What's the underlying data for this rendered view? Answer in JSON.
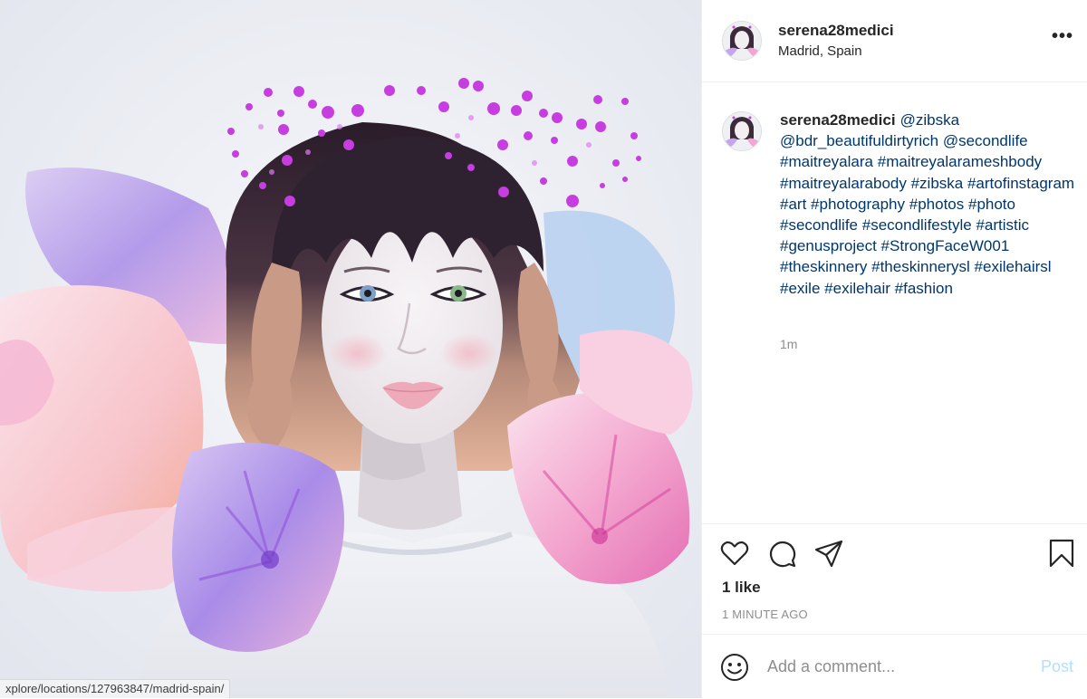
{
  "post": {
    "username": "serena28medici",
    "location": "Madrid, Spain",
    "more_icon": "more-options-icon"
  },
  "caption": {
    "username": "serena28medici",
    "mentions": [
      "@zibska",
      "@bdr_beautifuldirtyrich",
      "@secondlife"
    ],
    "hashtags": [
      "#maitreyalara",
      "#maitreyalarameshbody",
      "#maitreyalarabody",
      "#zibska",
      "#artofinstagram",
      "#art",
      "#photography",
      "#photos",
      "#photo",
      "#secondlife",
      "#secondlifestyle",
      "#artistic",
      "#genusproject",
      "#StrongFaceW001",
      "#theskinnery",
      "#theskinnerysl",
      "#exilehairsl",
      "#exile",
      "#exilehair",
      "#fashion"
    ],
    "time_ago": "1m"
  },
  "actions": {
    "icons": [
      "heart-icon",
      "comment-icon",
      "share-icon",
      "bookmark-icon"
    ],
    "likes": "1 like",
    "date": "1 MINUTE AGO"
  },
  "comment": {
    "placeholder": "Add a comment...",
    "post_label": "Post",
    "emoji_icon": "emoji-icon"
  },
  "status_bar": {
    "url": "xplore/locations/127963847/madrid-spain/"
  },
  "colors": {
    "link": "#00376b",
    "muted": "#8e8e8e",
    "post_disabled": "#b2dffc",
    "divider": "#efefef"
  }
}
